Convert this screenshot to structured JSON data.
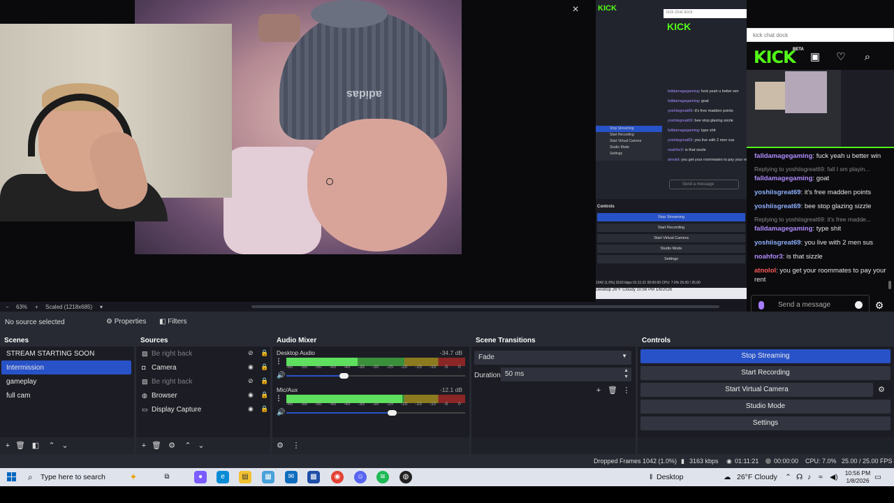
{
  "preview": {
    "close_glyph": "×",
    "zoom_percent": "63%",
    "scale_label": "Scaled (1218x685)",
    "cam_logo_text": "adidas",
    "nested": {
      "kick_label": "KICK",
      "dock_label": "kick chat dock",
      "controls_title": "Controls",
      "buttons": [
        "Stop Streaming",
        "Start Recording",
        "Start Virtual Camera",
        "Studio Mode",
        "Settings"
      ],
      "side_items": [
        "Stop Streaming",
        "Start Recording",
        "Start Virtual Camera",
        "Studio Mode",
        "Settings"
      ],
      "chat": [
        {
          "user": "falldamagegaming",
          "text": ": fuck yeah u better win"
        },
        {
          "user": "falldamagegaming",
          "text": ": goat"
        },
        {
          "user": "yoshiisgreat69",
          "text": ": it's free madden points"
        },
        {
          "user": "yoshiisgreat69",
          "text": ": bee stop glazing sizzle"
        },
        {
          "user": "falldamagegaming",
          "text": ": type shit"
        },
        {
          "user": "yoshiisgreat69",
          "text": ": you live with 2 men sus"
        },
        {
          "user": "noahfor3",
          "text": ": is that sizzle"
        },
        {
          "user": "atnolol",
          "text": ": you get your roommates to pay your rent"
        }
      ],
      "send_placeholder": "Send a message",
      "status": "1042 (1.0%)   3163 kbps   01:11:21   00:00:00   CPU: 7.0%   25.00 / 25.00",
      "taskbar": "Desktop   26°F Cloudy   10:56 PM 1/8/2026"
    }
  },
  "kick_dock": {
    "title": "kick chat dock",
    "logo": "KICK",
    "beta": "BETA",
    "icons": [
      "library-icon",
      "heart-icon",
      "search-icon"
    ],
    "messages": [
      {
        "user": "falldamagegaming",
        "text": ": fuck yeah u better win",
        "color": "#b18cff"
      },
      {
        "reply": "Replying to yoshiisgreat69: fall I sm playin..."
      },
      {
        "user": "falldamagegaming",
        "text": ": goat",
        "color": "#b18cff"
      },
      {
        "user": "yoshiisgreat69",
        "text": ": it's free madden points",
        "color": "#8fb0ff"
      },
      {
        "user": "yoshiisgreat69",
        "text": ": bee stop glazing sizzle",
        "color": "#8fb0ff"
      },
      {
        "reply": "Replying to yoshiisgreat69: it's free madde..."
      },
      {
        "user": "falldamagegaming",
        "text": ": type shit",
        "color": "#b18cff"
      },
      {
        "user": "yoshiisgreat69",
        "text": ": you live with 2 men sus",
        "color": "#8fb0ff"
      },
      {
        "user": "noahfor3",
        "text": ": is that sizzle",
        "color": "#b18cff"
      },
      {
        "user": "atnolol",
        "text": ": you get your roommates to pay your rent",
        "color": "#ff5b5b"
      }
    ],
    "send_placeholder": "Send a message"
  },
  "toolbar": {
    "no_source": "No source selected",
    "properties": "Properties",
    "filters": "Filters"
  },
  "scenes": {
    "title": "Scenes",
    "items": [
      "STREAM STARTING SOON",
      "Intermission",
      "gameplay",
      "full cam"
    ],
    "selected": "Intermission"
  },
  "sources": {
    "title": "Sources",
    "items": [
      {
        "label": "Be right back",
        "icon": "image-icon",
        "visible": false
      },
      {
        "label": "Camera",
        "icon": "camera-icon",
        "visible": true
      },
      {
        "label": "Be right back",
        "icon": "image-icon",
        "visible": false
      },
      {
        "label": "Browser",
        "icon": "globe-icon",
        "visible": true
      },
      {
        "label": "Display Capture",
        "icon": "monitor-icon",
        "visible": true
      }
    ]
  },
  "audio_mixer": {
    "title": "Audio Mixer",
    "scale": [
      "-60",
      "-55",
      "-50",
      "-45",
      "-40",
      "-35",
      "-30",
      "-25",
      "-20",
      "-15",
      "-10",
      "-5",
      "0"
    ],
    "channels": [
      {
        "name": "Desktop Audio",
        "db": "-34.7 dB",
        "level": 0.4,
        "volume": 0.32
      },
      {
        "name": "Mic/Aux",
        "db": "-12.1 dB",
        "level": 0.65,
        "volume": 0.59
      }
    ]
  },
  "transitions": {
    "title": "Scene Transitions",
    "selected": "Fade",
    "duration_label": "Duration",
    "duration_value": "50 ms"
  },
  "controls": {
    "title": "Controls",
    "buttons": [
      "Stop Streaming",
      "Start Recording",
      "Start Virtual Camera",
      "Studio Mode",
      "Settings"
    ]
  },
  "statusbar": {
    "dropped": "Dropped Frames 1042 (1.0%)",
    "bitrate": "3163 kbps",
    "stream_time": "01:11:21",
    "rec_time": "00:00:00",
    "cpu": "CPU: 7.0%",
    "fps": "25.00 / 25.00 FPS"
  },
  "taskbar": {
    "search_placeholder": "Type here to search",
    "desktop_label": "Desktop",
    "weather": "26°F  Cloudy",
    "time": "10:56 PM",
    "date": "1/8/2026",
    "accent": "#0067c0"
  }
}
